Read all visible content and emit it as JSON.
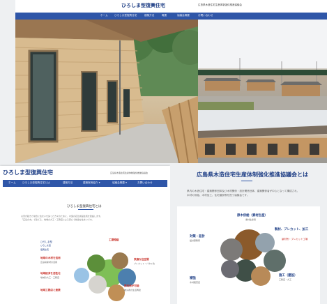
{
  "top": {
    "site_title": "ひろしま型復興住宅",
    "site_subtitle": "広島県木造住宅生産体制強化推進協議会",
    "nav": [
      "ホーム",
      "ひろしま型復興住宅",
      "建築方法",
      "概要",
      "協議会概要",
      "お問い合わせ"
    ]
  },
  "left_card": {
    "site_title": "ひろしま型復興住宅",
    "site_subtitle": "広島県木造住宅生産体制強化推進協議会",
    "nav": [
      "ホーム",
      "ひろしま型復興住宅とは",
      "建築方法",
      "建築実例紹介 ▾",
      "協議会概要 ▾",
      "お問い合わせ"
    ],
    "section_title": "ひろしま型復興住宅とは",
    "description_lines": [
      "災害が起きた場合に住まいを失った方々のために、木造の応急仮設住宅を建設します。",
      "「広島の木」で建てる、地域の大工・工務店による安心で快適な住まいです。"
    ],
    "diagram": {
      "center": [
        "ひろしま型",
        "ひろしま型",
        "復興住宅"
      ],
      "items": [
        "地域の木材を活用",
        "地域経済を活性化",
        "地域工務店と連携",
        "工期短縮",
        "快適な住空間",
        "再利用が可能"
      ],
      "details": [
        "広島県産材の活用",
        "地域の大工・工務店",
        "プレカット・パネル化",
        "被災者の生活再建"
      ]
    }
  },
  "right_panel": {
    "title": "広島県木造住宅生産体制強化推進協議会とは",
    "description_lines": [
      "県内の木造住宅・建築関係団体及び木材関係・設計関係団体、建築関係者が中心となって構成され、",
      "木材の供給、木材加工、住宅建設等を担う協議会です。"
    ],
    "diagram": {
      "items": [
        "原木供給（素材生産）",
        "対策・設計",
        "製材、プレカット、加工",
        "補強",
        "施工（建設）"
      ],
      "details": [
        "素材生産者",
        "設計事務所",
        "製材所・プレカット工場",
        "木材販売店",
        "工務店・大工"
      ]
    }
  },
  "colors": {
    "brand_blue": "#2f56a8",
    "title_blue": "#1f3f86",
    "accent_red": "#c8322a"
  }
}
